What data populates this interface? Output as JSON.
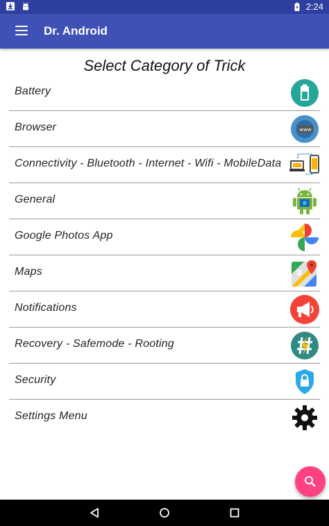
{
  "status_bar": {
    "time": "2:24",
    "icons": [
      "download-icon",
      "android-debug-icon",
      "battery-charging-icon"
    ]
  },
  "app_bar": {
    "title": "Dr. Android",
    "menu_icon": "hamburger-menu-icon"
  },
  "heading": "Select Category of Trick",
  "categories": [
    {
      "label": "Battery",
      "icon": "battery-icon"
    },
    {
      "label": "Browser",
      "icon": "www-globe-icon"
    },
    {
      "label": "Connectivity - Bluetooth - Internet - Wifi - MobileData",
      "icon": "device-sync-icon"
    },
    {
      "label": "General",
      "icon": "android-robot-icon"
    },
    {
      "label": "Google Photos App",
      "icon": "google-photos-pinwheel-icon"
    },
    {
      "label": "Maps",
      "icon": "google-maps-icon"
    },
    {
      "label": "Notifications",
      "icon": "megaphone-icon"
    },
    {
      "label": "Recovery - Safemode - Rooting",
      "icon": "hashtag-lightning-icon"
    },
    {
      "label": "Security",
      "icon": "shield-lock-icon"
    },
    {
      "label": "Settings Menu",
      "icon": "gear-icon"
    }
  ],
  "fab": {
    "icon": "search-icon"
  },
  "nav_bar": {
    "icons": [
      "back-icon",
      "home-icon",
      "recents-icon"
    ]
  },
  "colors": {
    "status_bar": "#2f3f9f",
    "app_bar": "#3f51b5",
    "fab": "#ff4081",
    "divider": "#9a9a9a"
  }
}
